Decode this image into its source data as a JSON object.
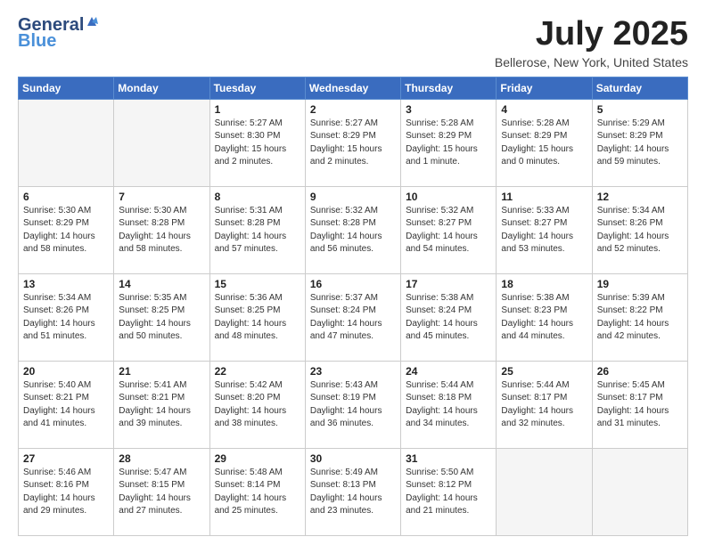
{
  "logo": {
    "general": "General",
    "blue": "Blue"
  },
  "title": "July 2025",
  "location": "Bellerose, New York, United States",
  "days": [
    "Sunday",
    "Monday",
    "Tuesday",
    "Wednesday",
    "Thursday",
    "Friday",
    "Saturday"
  ],
  "weeks": [
    [
      {
        "day": "",
        "content": ""
      },
      {
        "day": "",
        "content": ""
      },
      {
        "day": "1",
        "content": "Sunrise: 5:27 AM\nSunset: 8:30 PM\nDaylight: 15 hours\nand 2 minutes."
      },
      {
        "day": "2",
        "content": "Sunrise: 5:27 AM\nSunset: 8:29 PM\nDaylight: 15 hours\nand 2 minutes."
      },
      {
        "day": "3",
        "content": "Sunrise: 5:28 AM\nSunset: 8:29 PM\nDaylight: 15 hours\nand 1 minute."
      },
      {
        "day": "4",
        "content": "Sunrise: 5:28 AM\nSunset: 8:29 PM\nDaylight: 15 hours\nand 0 minutes."
      },
      {
        "day": "5",
        "content": "Sunrise: 5:29 AM\nSunset: 8:29 PM\nDaylight: 14 hours\nand 59 minutes."
      }
    ],
    [
      {
        "day": "6",
        "content": "Sunrise: 5:30 AM\nSunset: 8:29 PM\nDaylight: 14 hours\nand 58 minutes."
      },
      {
        "day": "7",
        "content": "Sunrise: 5:30 AM\nSunset: 8:28 PM\nDaylight: 14 hours\nand 58 minutes."
      },
      {
        "day": "8",
        "content": "Sunrise: 5:31 AM\nSunset: 8:28 PM\nDaylight: 14 hours\nand 57 minutes."
      },
      {
        "day": "9",
        "content": "Sunrise: 5:32 AM\nSunset: 8:28 PM\nDaylight: 14 hours\nand 56 minutes."
      },
      {
        "day": "10",
        "content": "Sunrise: 5:32 AM\nSunset: 8:27 PM\nDaylight: 14 hours\nand 54 minutes."
      },
      {
        "day": "11",
        "content": "Sunrise: 5:33 AM\nSunset: 8:27 PM\nDaylight: 14 hours\nand 53 minutes."
      },
      {
        "day": "12",
        "content": "Sunrise: 5:34 AM\nSunset: 8:26 PM\nDaylight: 14 hours\nand 52 minutes."
      }
    ],
    [
      {
        "day": "13",
        "content": "Sunrise: 5:34 AM\nSunset: 8:26 PM\nDaylight: 14 hours\nand 51 minutes."
      },
      {
        "day": "14",
        "content": "Sunrise: 5:35 AM\nSunset: 8:25 PM\nDaylight: 14 hours\nand 50 minutes."
      },
      {
        "day": "15",
        "content": "Sunrise: 5:36 AM\nSunset: 8:25 PM\nDaylight: 14 hours\nand 48 minutes."
      },
      {
        "day": "16",
        "content": "Sunrise: 5:37 AM\nSunset: 8:24 PM\nDaylight: 14 hours\nand 47 minutes."
      },
      {
        "day": "17",
        "content": "Sunrise: 5:38 AM\nSunset: 8:24 PM\nDaylight: 14 hours\nand 45 minutes."
      },
      {
        "day": "18",
        "content": "Sunrise: 5:38 AM\nSunset: 8:23 PM\nDaylight: 14 hours\nand 44 minutes."
      },
      {
        "day": "19",
        "content": "Sunrise: 5:39 AM\nSunset: 8:22 PM\nDaylight: 14 hours\nand 42 minutes."
      }
    ],
    [
      {
        "day": "20",
        "content": "Sunrise: 5:40 AM\nSunset: 8:21 PM\nDaylight: 14 hours\nand 41 minutes."
      },
      {
        "day": "21",
        "content": "Sunrise: 5:41 AM\nSunset: 8:21 PM\nDaylight: 14 hours\nand 39 minutes."
      },
      {
        "day": "22",
        "content": "Sunrise: 5:42 AM\nSunset: 8:20 PM\nDaylight: 14 hours\nand 38 minutes."
      },
      {
        "day": "23",
        "content": "Sunrise: 5:43 AM\nSunset: 8:19 PM\nDaylight: 14 hours\nand 36 minutes."
      },
      {
        "day": "24",
        "content": "Sunrise: 5:44 AM\nSunset: 8:18 PM\nDaylight: 14 hours\nand 34 minutes."
      },
      {
        "day": "25",
        "content": "Sunrise: 5:44 AM\nSunset: 8:17 PM\nDaylight: 14 hours\nand 32 minutes."
      },
      {
        "day": "26",
        "content": "Sunrise: 5:45 AM\nSunset: 8:17 PM\nDaylight: 14 hours\nand 31 minutes."
      }
    ],
    [
      {
        "day": "27",
        "content": "Sunrise: 5:46 AM\nSunset: 8:16 PM\nDaylight: 14 hours\nand 29 minutes."
      },
      {
        "day": "28",
        "content": "Sunrise: 5:47 AM\nSunset: 8:15 PM\nDaylight: 14 hours\nand 27 minutes."
      },
      {
        "day": "29",
        "content": "Sunrise: 5:48 AM\nSunset: 8:14 PM\nDaylight: 14 hours\nand 25 minutes."
      },
      {
        "day": "30",
        "content": "Sunrise: 5:49 AM\nSunset: 8:13 PM\nDaylight: 14 hours\nand 23 minutes."
      },
      {
        "day": "31",
        "content": "Sunrise: 5:50 AM\nSunset: 8:12 PM\nDaylight: 14 hours\nand 21 minutes."
      },
      {
        "day": "",
        "content": ""
      },
      {
        "day": "",
        "content": ""
      }
    ]
  ]
}
